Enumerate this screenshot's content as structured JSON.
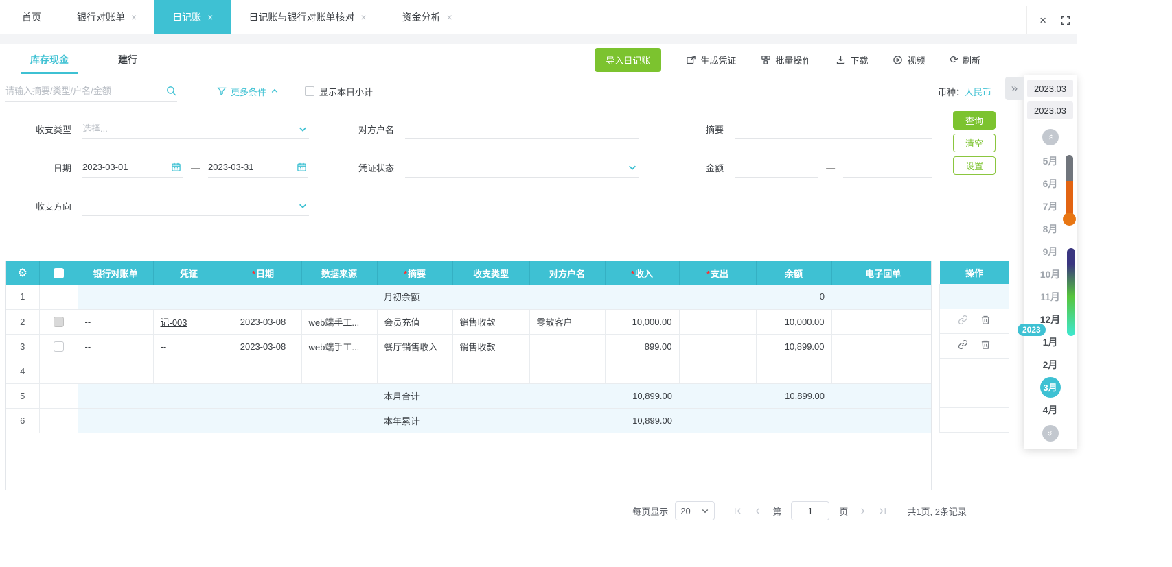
{
  "colors": {
    "accent": "#3ec1d3",
    "green": "#7cc32f",
    "summary_row_bg": "#eef8fd",
    "required_red": "#ff2d2d"
  },
  "window": {
    "tab_close_glyph": "×",
    "close_glyph": "×",
    "top_tabs": [
      {
        "label": "首页",
        "closable": false
      },
      {
        "label": "银行对账单",
        "closable": true
      },
      {
        "label": "日记账",
        "closable": true,
        "active": true
      },
      {
        "label": "日记账与银行对账单核对",
        "closable": true
      },
      {
        "label": "资金分析",
        "closable": true
      }
    ]
  },
  "account_tabs": [
    {
      "label": "库存现金",
      "active": true
    },
    {
      "label": "建行",
      "active": false
    }
  ],
  "toolbar": {
    "import_label": "导入日记账",
    "generate_label": "生成凭证",
    "batch_label": "批量操作",
    "download_label": "下载",
    "video_label": "视频",
    "refresh_label": "刷新",
    "refresh_glyph": "⟳"
  },
  "search": {
    "placeholder": "请输入摘要/类型/户名/金额",
    "more_label": "更多条件",
    "show_subtotal_label": "显示本日小计",
    "currency_label": "币种：",
    "currency_value": "人民币"
  },
  "filters": {
    "type_label": "收支类型",
    "type_placeholder": "选择...",
    "counterparty_label": "对方户名",
    "summary_label": "摘要",
    "date_label": "日期",
    "date_from": "2023-03-01",
    "date_to": "2023-03-31",
    "range_dash": "—",
    "voucher_status_label": "凭证状态",
    "amount_label": "金额",
    "direction_label": "收支方向",
    "query_label": "查询",
    "clear_label": "清空",
    "settings_label": "设置"
  },
  "table": {
    "required_marker": "*",
    "headers": {
      "bank": "银行对账单",
      "voucher": "凭证",
      "date": "日期",
      "source": "数据来源",
      "summary": "摘要",
      "type": "收支类型",
      "counterparty": "对方户名",
      "income": "收入",
      "expense": "支出",
      "balance": "余额",
      "receipt": "电子回单",
      "ops": "操作"
    },
    "rows": [
      {
        "num": "1",
        "summary": "月初余额",
        "balance": "0"
      },
      {
        "num": "2",
        "bank": "--",
        "voucher": "记-003",
        "date": "2023-03-08",
        "source": "web端手工...",
        "summary": "会员充值",
        "type": "销售收款",
        "counterparty": "零散客户",
        "income": "10,000.00",
        "balance": "10,000.00"
      },
      {
        "num": "3",
        "bank": "--",
        "voucher": "--",
        "date": "2023-03-08",
        "source": "web端手工...",
        "summary": "餐厅销售收入",
        "type": "销售收款",
        "income": "899.00",
        "balance": "10,899.00"
      },
      {
        "num": "4"
      },
      {
        "num": "5",
        "summary": "本月合计",
        "income": "10,899.00",
        "balance": "10,899.00"
      },
      {
        "num": "6",
        "summary": "本年累计",
        "income": "10,899.00"
      }
    ]
  },
  "pagination": {
    "per_page_label": "每页显示",
    "per_page_value": "20",
    "page_prefix": "第",
    "page_value": "1",
    "page_suffix": "页",
    "total_text": "共1页, 2条记录"
  },
  "month_panel": {
    "collapse_glyph": "»",
    "scroll_glyph": "»",
    "period_top": "2023.03",
    "period_selected": "2023.03",
    "year_badge": "2023",
    "months": [
      {
        "label": "5月",
        "state": "dim"
      },
      {
        "label": "6月",
        "state": "dim"
      },
      {
        "label": "7月",
        "state": "dim"
      },
      {
        "label": "8月",
        "state": "dim"
      },
      {
        "label": "9月",
        "state": "dim"
      },
      {
        "label": "10月",
        "state": "dim"
      },
      {
        "label": "11月",
        "state": "dim"
      },
      {
        "label": "12月",
        "state": "normal"
      },
      {
        "label": "1月",
        "state": "normal"
      },
      {
        "label": "2月",
        "state": "normal"
      },
      {
        "label": "3月",
        "state": "selected"
      },
      {
        "label": "4月",
        "state": "normal"
      }
    ]
  }
}
